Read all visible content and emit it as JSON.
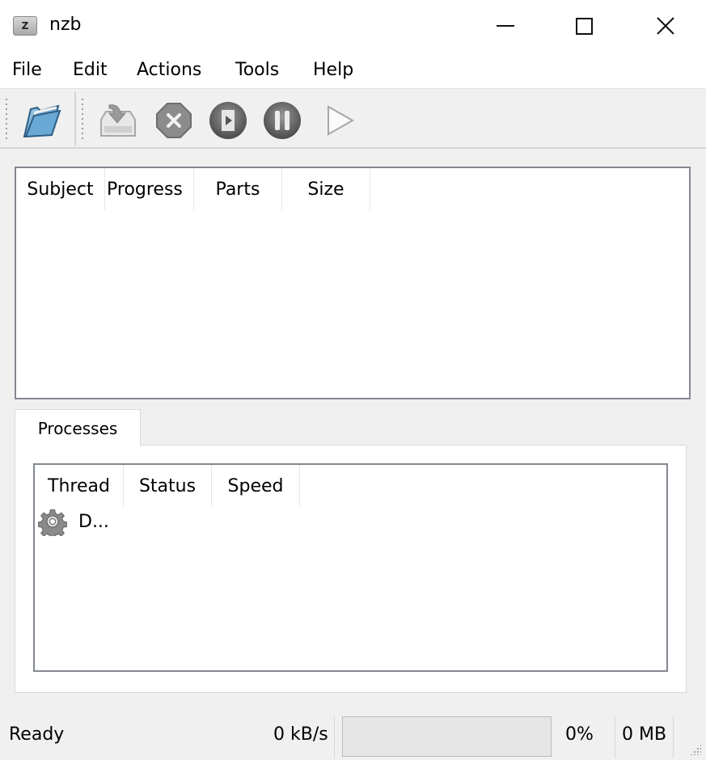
{
  "window": {
    "title": "nzb",
    "app_icon": "nzb-app-icon",
    "app_icon_text": "Z",
    "controls": [
      "minimize",
      "maximize",
      "close"
    ]
  },
  "menubar": {
    "items": [
      {
        "label": "File"
      },
      {
        "label": "Edit"
      },
      {
        "label": "Actions"
      },
      {
        "label": "Tools"
      },
      {
        "label": "Help"
      }
    ]
  },
  "toolbar": {
    "buttons": [
      {
        "icon": "open-folder-icon",
        "tooltip": "Open"
      },
      {
        "icon": "import-tray-icon",
        "tooltip": "Import"
      },
      {
        "icon": "stop-icon",
        "tooltip": "Stop"
      },
      {
        "icon": "play-film-icon",
        "tooltip": "Start"
      },
      {
        "icon": "pause-icon",
        "tooltip": "Pause"
      },
      {
        "icon": "play-icon",
        "tooltip": "Resume"
      }
    ]
  },
  "downloads": {
    "columns": [
      "Subject",
      "Progress",
      "Parts",
      "Size"
    ],
    "rows": []
  },
  "tabs": {
    "active": "Processes",
    "items": [
      {
        "label": "Processes"
      }
    ]
  },
  "processes": {
    "columns": [
      "Thread",
      "Status",
      "Speed"
    ],
    "rows": [
      {
        "icon": "gear-icon",
        "thread": "D...",
        "status": "",
        "speed": ""
      }
    ]
  },
  "statusbar": {
    "status": "Ready",
    "speed": "0 kB/s",
    "progress_percent": 0,
    "progress_label": "0%",
    "size": "0 MB"
  }
}
